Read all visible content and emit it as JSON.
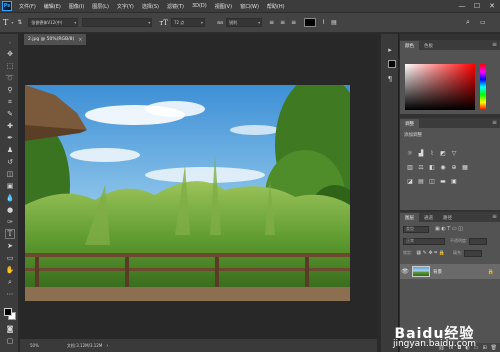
{
  "app": {
    "logo_text": "Ps"
  },
  "menubar": {
    "items": [
      "文件(F)",
      "编辑(E)",
      "图像(I)",
      "图层(L)",
      "文字(Y)",
      "选择(S)",
      "滤镜(T)",
      "3D(D)",
      "视图(V)",
      "窗口(W)",
      "帮助(H)"
    ]
  },
  "window_controls": {
    "minimize": "—",
    "maximize": "☐",
    "close": "✕"
  },
  "options_bar": {
    "tool_icon": "T",
    "font_family": "张俊德体V12(中)",
    "font_style": "",
    "font_size": "72 点",
    "antialias": "锐利",
    "text_color": "#000000"
  },
  "document": {
    "tab_label": "2.jpg @ 50%(RGB/8)",
    "zoom": "50%",
    "doc_info": "文档:3.12M/3.12M"
  },
  "color_panel": {
    "tabs": [
      "颜色",
      "色板"
    ],
    "foreground": "#000000",
    "background": "#ffffff"
  },
  "adjustments_panel": {
    "tabs": [
      "调整"
    ],
    "add_label": "添加调整"
  },
  "layers_panel": {
    "tabs": [
      "图层",
      "通道",
      "路径"
    ],
    "kind_placeholder": "类型",
    "blend_mode": "正常",
    "opacity_label": "不透明度:",
    "lock_label": "锁定:",
    "fill_label": "填充:",
    "layers": [
      {
        "name": "背景",
        "visible": true,
        "locked": true
      }
    ]
  },
  "watermark": {
    "logo": "Baidu经验",
    "url": "jingyan.baidu.com"
  }
}
